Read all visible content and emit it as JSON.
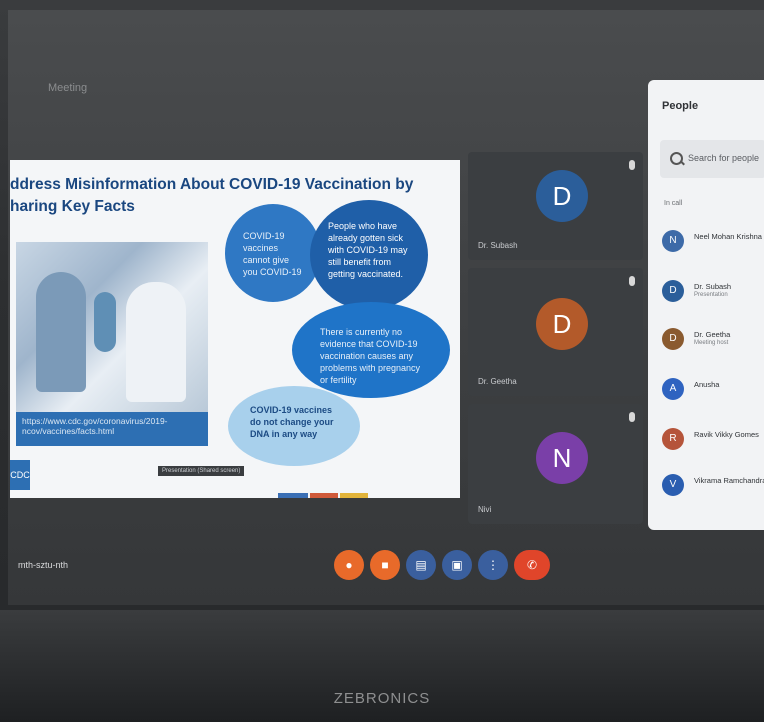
{
  "meeting": {
    "title": "Meeting",
    "code": "mth-sztu-nth"
  },
  "slide": {
    "title_line1": "ddress Misinformation About COVID-19 Vaccination by",
    "title_line2": "haring Key Facts",
    "url_text": "https://www.cdc.gov/coronavirus/2019-ncov/vaccines/facts.html",
    "corner": "CDC",
    "bubble1": "COVID-19 vaccines cannot give you COVID-19",
    "bubble2": "People who have already gotten sick with COVID-19 may still benefit from getting vaccinated.",
    "bubble3": "There is currently no evidence that COVID-19 vaccination causes any problems with pregnancy or fertility",
    "bubble4": "COVID-19 vaccines do not change your DNA in any way",
    "caption": "Presentation (Shared screen)"
  },
  "participants": [
    {
      "initial": "D",
      "name": "Dr. Subash",
      "color": "#2b5e9a"
    },
    {
      "initial": "D",
      "name": "Dr. Geetha",
      "color": "#b35a2a"
    },
    {
      "initial": "N",
      "name": "Nivi",
      "color": "#7a3fa8"
    }
  ],
  "people_panel": {
    "title": "People",
    "search_placeholder": "Search for people",
    "section_label": "In call",
    "people": [
      {
        "initial": "N",
        "name": "Neel Mohan Krishna",
        "sub": "",
        "color": "#3d6aa8"
      },
      {
        "initial": "D",
        "name": "Dr. Subash",
        "sub": "Presentation",
        "color": "#2b5e9a"
      },
      {
        "initial": "D",
        "name": "Dr. Geetha",
        "sub": "Meeting host",
        "color": "#8a5a2f"
      },
      {
        "initial": "A",
        "name": "Anusha",
        "sub": "",
        "color": "#2f63c0"
      },
      {
        "initial": "R",
        "name": "Ravik Vikky Gomes",
        "sub": "",
        "color": "#b5543a"
      },
      {
        "initial": "V",
        "name": "Vikrama Ramchandran",
        "sub": "",
        "color": "#2a5db0"
      }
    ]
  },
  "controls": [
    {
      "icon": "mic-icon",
      "glyph": "●",
      "color": "#e86a2a"
    },
    {
      "icon": "camera-icon",
      "glyph": "■",
      "color": "#e86a2a"
    },
    {
      "icon": "captions-icon",
      "glyph": "▤",
      "color": "#3a5f9e"
    },
    {
      "icon": "present-icon",
      "glyph": "▣",
      "color": "#3a5f9e"
    },
    {
      "icon": "more-icon",
      "glyph": "⋮",
      "color": "#3a5f9e"
    },
    {
      "icon": "end-call-icon",
      "glyph": "✆",
      "color": "#e0452a"
    }
  ],
  "brand": "ZEBRONICS"
}
